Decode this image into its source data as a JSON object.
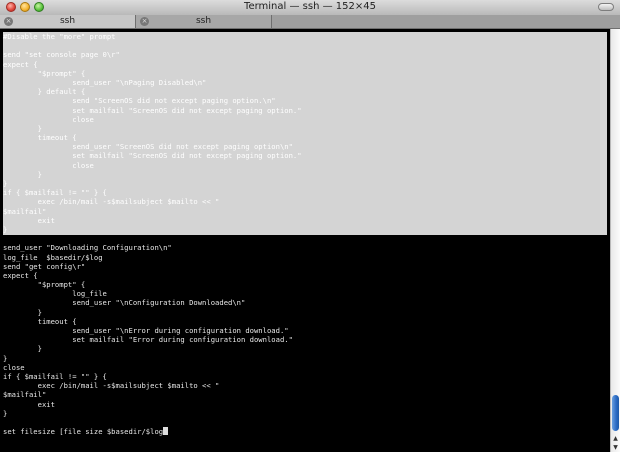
{
  "window": {
    "title": "Terminal — ssh — 152×45"
  },
  "tabs": [
    {
      "label": "ssh",
      "close": "×"
    },
    {
      "label": "ssh",
      "close": "×"
    }
  ],
  "terminal": {
    "selected_lines": [
      "#Disable the \"more\" prompt",
      "",
      "send \"set console page 0\\r\"",
      "expect {",
      "        \"$prompt\" {",
      "                send_user \"\\nPaging Disabled\\n\"",
      "        } default {",
      "                send \"ScreenOS did not except paging option.\\n\"",
      "                set mailfail \"ScreenOS did not except paging option.\"",
      "                close",
      "        }",
      "        timeout {",
      "                send_user \"ScreenOS did not except paging option\\n\"",
      "                set mailfail \"ScreenOS did not except paging option.\"",
      "                close",
      "        }",
      "}",
      "if { $mailfail != \"\" } {",
      "        exec /bin/mail -s$mailsubject $mailto << \"",
      "$mailfail\"",
      "        exit",
      "}"
    ],
    "lines": [
      "",
      "send_user \"Downloading Configuration\\n\"",
      "log_file  $basedir/$log",
      "send \"get config\\r\"",
      "expect {",
      "        \"$prompt\" {",
      "                log_file",
      "                send_user \"\\nConfiguration Downloaded\\n\"",
      "        }",
      "        timeout {",
      "                send_user \"\\nError during configuration download.\"",
      "                set mailfail \"Error during configuration download.\"",
      "        }",
      "}",
      "close",
      "if { $mailfail != \"\" } {",
      "        exec /bin/mail -s$mailsubject $mailto << \"",
      "$mailfail\"",
      "        exit",
      "}",
      "",
      "set filesize [file size $basedir/$log"
    ]
  }
}
